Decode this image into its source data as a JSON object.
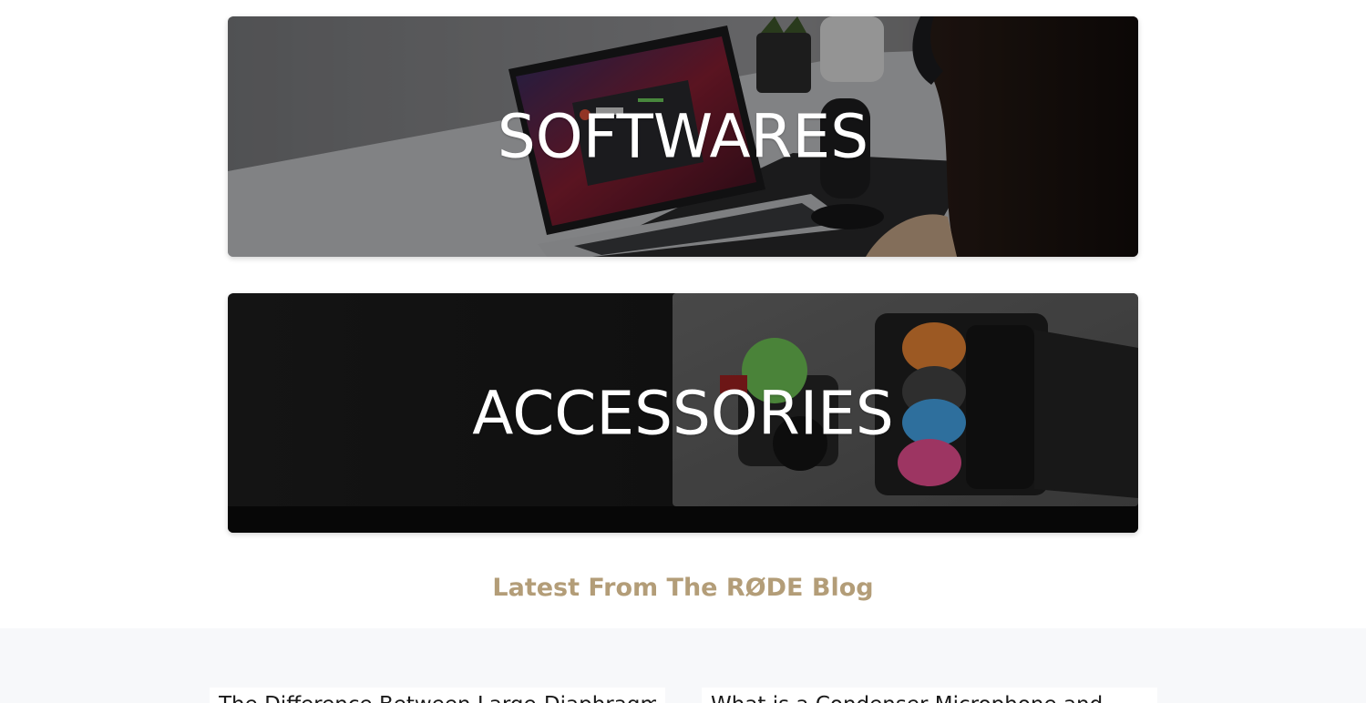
{
  "categories": {
    "softwares": {
      "title": "SOFTWARES"
    },
    "accessories": {
      "title": "ACCESSORIES"
    }
  },
  "blog": {
    "heading": "Latest From The RØDE Blog",
    "posts": [
      {
        "title": "The Difference Between Large-Diaphragm"
      },
      {
        "title": "What is a Condenser Microphone and"
      }
    ]
  },
  "colors": {
    "blog_heading": "#b39d78",
    "blog_section_bg": "#f7f8fa"
  }
}
